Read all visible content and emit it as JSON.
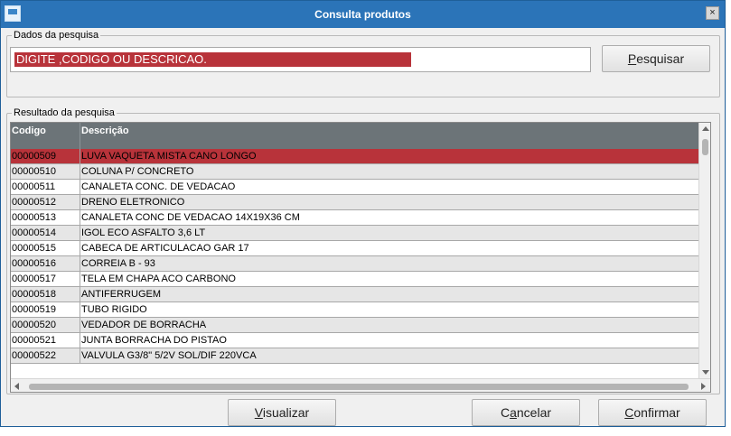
{
  "window": {
    "title": "Consulta produtos",
    "close_glyph": "×"
  },
  "search_group": {
    "legend": "Dados da pesquisa",
    "input_value": "DIGITE ,CODIGO OU DESCRICAO.",
    "button_key": "P",
    "button_rest": "esquisar"
  },
  "results_group": {
    "legend": "Resultado da pesquisa",
    "columns": [
      "Codigo",
      "Descrição"
    ],
    "rows": [
      {
        "code": "00000509",
        "desc": "LUVA VAQUETA MISTA  CANO LONGO"
      },
      {
        "code": "00000510",
        "desc": "COLUNA P/ CONCRETO"
      },
      {
        "code": "00000511",
        "desc": "CANALETA CONC. DE VEDACAO"
      },
      {
        "code": "00000512",
        "desc": "DRENO ELETRONICO"
      },
      {
        "code": "00000513",
        "desc": "CANALETA CONC DE VEDACAO 14X19X36 CM"
      },
      {
        "code": "00000514",
        "desc": "IGOL ECO ASFALTO 3,6 LT"
      },
      {
        "code": "00000515",
        "desc": "CABECA DE ARTICULACAO GAR 17"
      },
      {
        "code": "00000516",
        "desc": "CORREIA B - 93"
      },
      {
        "code": "00000517",
        "desc": "TELA EM CHAPA ACO CARBONO"
      },
      {
        "code": "00000518",
        "desc": "ANTIFERRUGEM"
      },
      {
        "code": "00000519",
        "desc": "TUBO RIGIDO"
      },
      {
        "code": "00000520",
        "desc": "VEDADOR DE BORRACHA"
      },
      {
        "code": "00000521",
        "desc": "JUNTA BORRACHA DO PISTAO"
      },
      {
        "code": "00000522",
        "desc": "VALVULA G3/8\" 5/2V SOL/DIF 220VCA"
      }
    ],
    "selected_index": 0
  },
  "buttons": {
    "view_key": "V",
    "view_rest": "isualizar",
    "cancel_pre": "C",
    "cancel_key": "a",
    "cancel_rest": "ncelar",
    "confirm_key": "C",
    "confirm_rest": "onfirmar"
  },
  "colors": {
    "titlebar": "#2b74b8",
    "selection": "#b8333a",
    "grid_header": "#6c7478"
  },
  "icons": [
    "app-window-icon",
    "close-icon",
    "scroll-up-icon",
    "scroll-down-icon",
    "scroll-left-icon",
    "scroll-right-icon"
  ]
}
